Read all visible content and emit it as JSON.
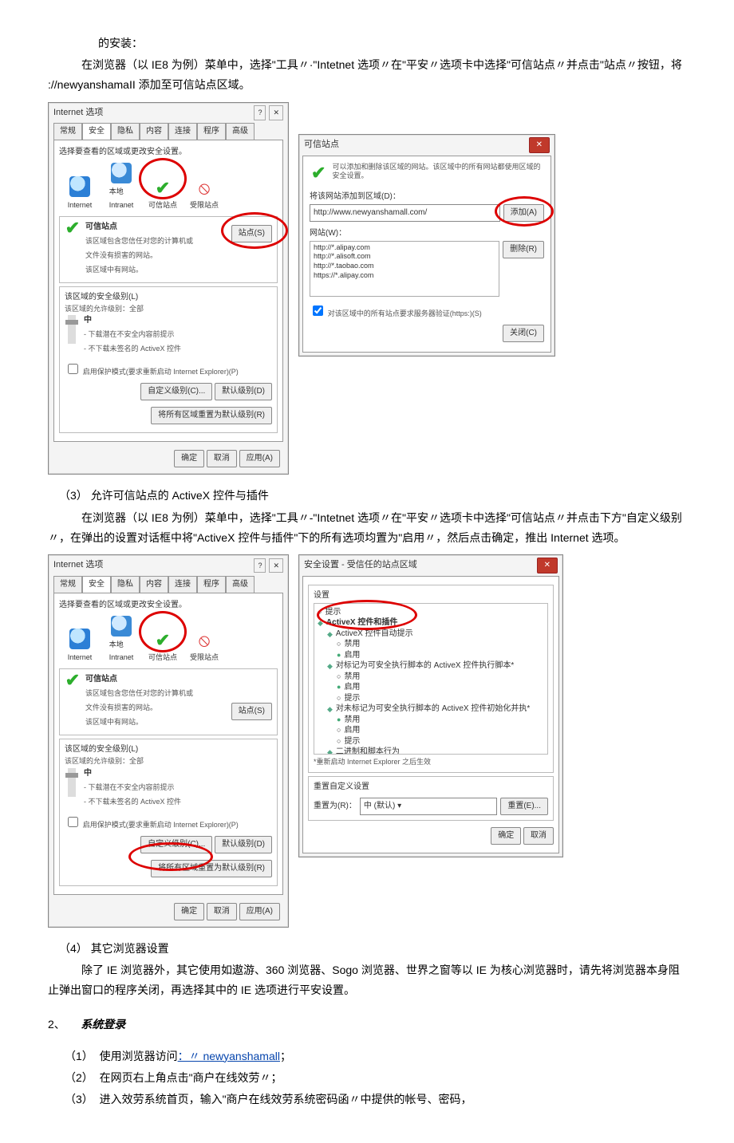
{
  "para": {
    "p0": "的安装：",
    "p1": "在浏览器（以 IE8 为例）菜单中，选择\"工具〃·\"Intetnet 选项〃在\"平安〃选项卡中选择\"可信站点〃并点击\"站点〃按钮，将 ://newyanshamaII 添加至可信站点区域。",
    "s3num": "（3）",
    "s3title": "允许可信站点的 ActiveX 控件与插件",
    "p3": "在浏览器（以 IE8 为例）菜单中，选择\"工具〃-\"Intetnet 选项〃在\"平安〃选项卡中选择\"可信站点〃并点击下方\"自定义级别〃，在弹出的设置对话框中将\"ActiveX 控件与插件\"下的所有选项均置为\"启用〃，然后点击确定，推出 Internet 选项。",
    "s4num": "（4）",
    "s4title": "其它浏览器设置",
    "p4": "除了 IE 浏览器外，其它使用如遨游、360 浏览器、Sogo 浏览器、世界之窗等以 IE 为核心浏览器时，请先将浏览器本身阻止弹出窗口的程序关闭，再选择其中的 IE 选项进行平安设置。",
    "loginHeadNum": "2、",
    "loginHead": "系统登录",
    "l1n": "（1）",
    "l1a": "使用浏览器访问",
    "l1b": "：〃 newyanshamall",
    "l1c": "；",
    "l2n": "（2）",
    "l2": "在网页右上角点击\"商户在线效劳〃；",
    "l3n": "（3）",
    "l3": "进入效劳系统首页，输入\"商户在线效劳系统密码函〃中提供的帐号、密码，"
  },
  "dlg1": {
    "title": "Internet 选项",
    "help": "?",
    "close": "✕",
    "tabs": {
      "t1": "常规",
      "t2": "安全",
      "t3": "隐私",
      "t4": "内容",
      "t5": "连接",
      "t6": "程序",
      "t7": "高级"
    },
    "zoneLabel": "选择要查看的区域或更改安全设置。",
    "zones": {
      "z1": "Internet",
      "z2": "本地\nIntranet",
      "z3": "可信站点",
      "z4": "受限站点"
    },
    "trusted": {
      "title": "可信站点",
      "desc": "该区域包含您信任对您的计算机或\n文件没有损害的网站。",
      "sub": "该区域中有网站。"
    },
    "sitesBtn": "站点(S)",
    "levelTitle": "该区域的安全级别(L)",
    "levelAllow": "该区域的允许级别：全部",
    "levelMid": "中",
    "levelNote1": "- 下载潜在不安全内容前提示",
    "levelNote2": "- 不下载未签名的 ActiveX 控件",
    "protectChk": "启用保护模式(要求重新启动 Internet Explorer)(P)",
    "customBtn": "自定义级别(C)...",
    "defaultBtn": "默认级别(D)",
    "resetBtn": "将所有区域重置为默认级别(R)",
    "ok": "确定",
    "cancel": "取消",
    "apply": "应用(A)"
  },
  "dlg2": {
    "title": "可信站点",
    "desc": "可以添加和删除该区域的网站。该区域中的所有网站都使用区域的安全设置。",
    "addLabel": "将该网站添加到区域(D)：",
    "addValue": "http://www.newyanshamall.com/",
    "addBtn": "添加(A)",
    "listLabel": "网站(W)：",
    "sites": [
      "http://*.alipay.com",
      "http://*.alisoft.com",
      "http://*.taobao.com",
      "https://*.alipay.com"
    ],
    "removeBtn": "删除(R)",
    "httpsChk": "对该区域中的所有站点要求服务器验证(https:)(S)",
    "closeBtn": "关闭(C)"
  },
  "dlg3": {
    "title": "安全设置 - 受信任的站点区域",
    "settings": "设置",
    "items": {
      "prompt": "提示",
      "activex": "ActiveX 控件和插件",
      "axprompt": "ActiveX 控件自动提示",
      "disable": "禁用",
      "enable": "启用",
      "label1": "对标记为可安全执行脚本的 ActiveX 控件执行脚本*",
      "label2": "对未标记为可安全执行脚本的 ActiveX 控件初始化并执*",
      "label3": "二进制和脚本行为"
    },
    "restartNote": "*重新启动 Internet Explorer 之后生效",
    "resetGroup": "重置自定义设置",
    "resetTo": "重置为(R)：",
    "resetVal": "中 (默认)",
    "resetBtn": "重置(E)...",
    "ok": "确定",
    "cancel": "取消"
  }
}
